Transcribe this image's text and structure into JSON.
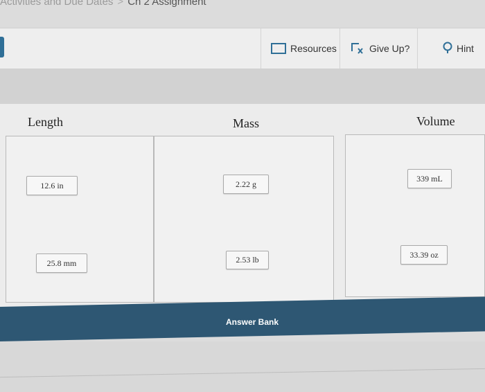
{
  "breadcrumb": {
    "parent": "Activities and Due Dates",
    "separator": ">",
    "current": "Ch 2 Assignment"
  },
  "toolbar": {
    "resources_label": "Resources",
    "giveup_label": "Give Up?",
    "hint_label": "Hint"
  },
  "columns": {
    "length": {
      "title": "Length",
      "items": [
        "12.6 in",
        "25.8 mm"
      ]
    },
    "mass": {
      "title": "Mass",
      "items": [
        "2.22 g",
        "2.53 lb"
      ]
    },
    "volume": {
      "title": "Volume",
      "items": [
        "339 mL",
        "33.39 oz"
      ]
    }
  },
  "answer_bank": {
    "label": "Answer Bank"
  },
  "colors": {
    "accent": "#2e5773",
    "background": "#dcdcdc"
  }
}
